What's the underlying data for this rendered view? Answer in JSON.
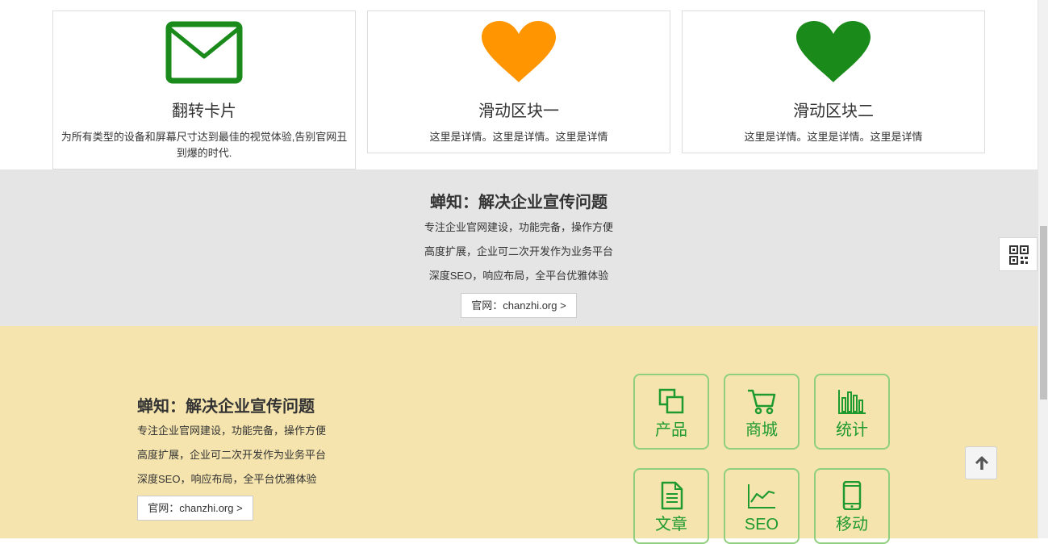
{
  "cards": [
    {
      "title": "翻转卡片",
      "desc": "为所有类型的设备和屏幕尺寸达到最佳的视觉体验,告别官网丑到爆的时代.",
      "icon": "mail-icon",
      "color": "#1a8a1a"
    },
    {
      "title": "滑动区块一",
      "desc": "这里是详情。这里是详情。这里是详情",
      "icon": "heart-icon",
      "color": "#ff9500"
    },
    {
      "title": "滑动区块二",
      "desc": "这里是详情。这里是详情。这里是详情",
      "icon": "heart-icon",
      "color": "#1a8a1a"
    }
  ],
  "gray_band": {
    "title": "蝉知：解决企业宣传问题",
    "lines": [
      "专注企业官网建设，功能完备，操作方便",
      "高度扩展，企业可二次开发作为业务平台",
      "深度SEO，响应布局，全平台优雅体验"
    ],
    "button": "官网：chanzhi.org >"
  },
  "yellow_band": {
    "title": "蝉知：解决企业宣传问题",
    "lines": [
      "专注企业官网建设，功能完备，操作方便",
      "高度扩展，企业可二次开发作为业务平台",
      "深度SEO，响应布局，全平台优雅体验"
    ],
    "button": "官网：chanzhi.org >",
    "tiles": [
      {
        "label": "产品",
        "icon": "product-icon"
      },
      {
        "label": "商城",
        "icon": "cart-icon"
      },
      {
        "label": "统计",
        "icon": "bar-chart-icon"
      },
      {
        "label": "文章",
        "icon": "document-icon"
      },
      {
        "label": "SEO",
        "icon": "line-chart-icon"
      },
      {
        "label": "移动",
        "icon": "mobile-icon"
      }
    ],
    "accent": "#1e9a2e",
    "background": "#f5e4ae"
  },
  "floating": {
    "qr_icon": "qr-code-icon",
    "top_icon": "arrow-up-icon"
  }
}
